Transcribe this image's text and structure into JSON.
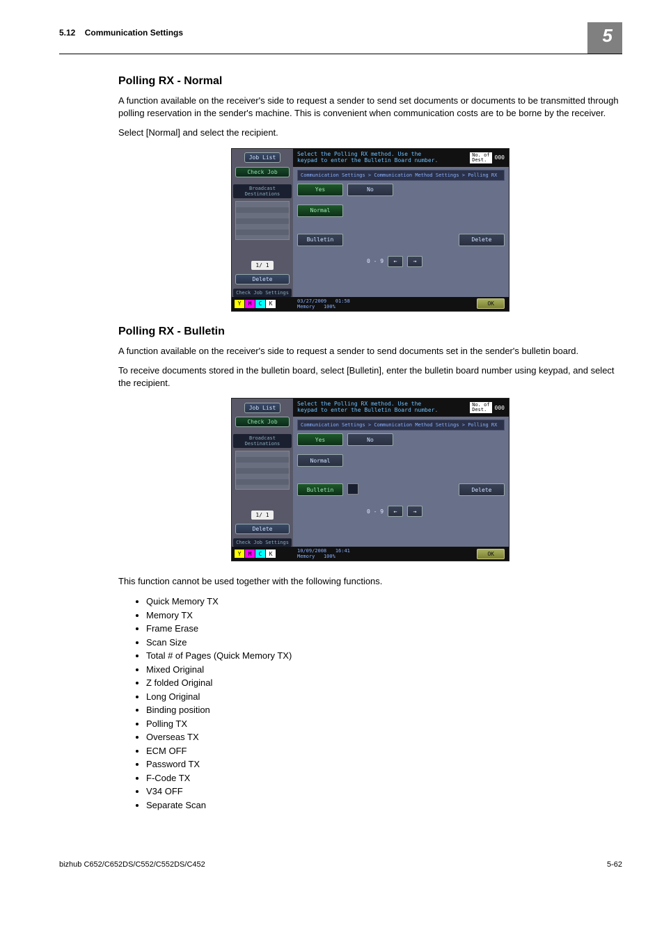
{
  "header": {
    "section_no": "5.12",
    "section_title": "Communication Settings",
    "chapter_no": "5"
  },
  "sec1": {
    "title": "Polling RX - Normal",
    "p1": "A function available on the receiver's side to request a sender to send set documents or documents to be transmitted through polling reservation in the sender's machine. This is convenient when communication costs are to be borne by the receiver.",
    "p2": "Select [Normal] and select the recipient."
  },
  "sec2": {
    "title": "Polling RX - Bulletin",
    "p1": "A function available on the receiver's side to request a sender to send documents set in the sender's bulletin board.",
    "p2": "To receive documents stored in the bulletin board, select [Bulletin], enter the bulletin board number using keypad, and select the recipient.",
    "after": "This function cannot be used together with the following functions.",
    "limits": [
      "Quick Memory TX",
      "Memory TX",
      "Frame Erase",
      "Scan Size",
      "Total # of Pages (Quick Memory TX)",
      "Mixed Original",
      "Z folded Original",
      "Long Original",
      "Binding position",
      "Polling TX",
      "Overseas TX",
      "ECM OFF",
      "Password TX",
      "F-Code TX",
      "V34 OFF",
      "Separate Scan"
    ]
  },
  "shot": {
    "job_list": "Job List",
    "check_job": "Check Job",
    "broadcast": "Broadcast\nDestinations",
    "prompt": "Select the Polling RX method. Use the\nkeypad to enter the Bulletin Board number.",
    "dest_label": "No. of\nDest.",
    "dest_count": "000",
    "crumb": "Communication Settings > Communication Method Settings > Polling RX",
    "yes": "Yes",
    "no": "No",
    "normal": "Normal",
    "bulletin": "Bulletin",
    "delete": "Delete",
    "range": "0 - 9",
    "page_ind": "1/  1",
    "side_delete": "Delete",
    "check_settings": "Check Job\nSettings",
    "ok": "OK",
    "memory": "Memory",
    "mem_pct": "100%",
    "dt1_date": "03/27/2009",
    "dt1_time": "01:58",
    "dt2_date": "10/09/2008",
    "dt2_time": "16:41"
  },
  "footer": {
    "model": "bizhub C652/C652DS/C552/C552DS/C452",
    "page": "5-62"
  }
}
